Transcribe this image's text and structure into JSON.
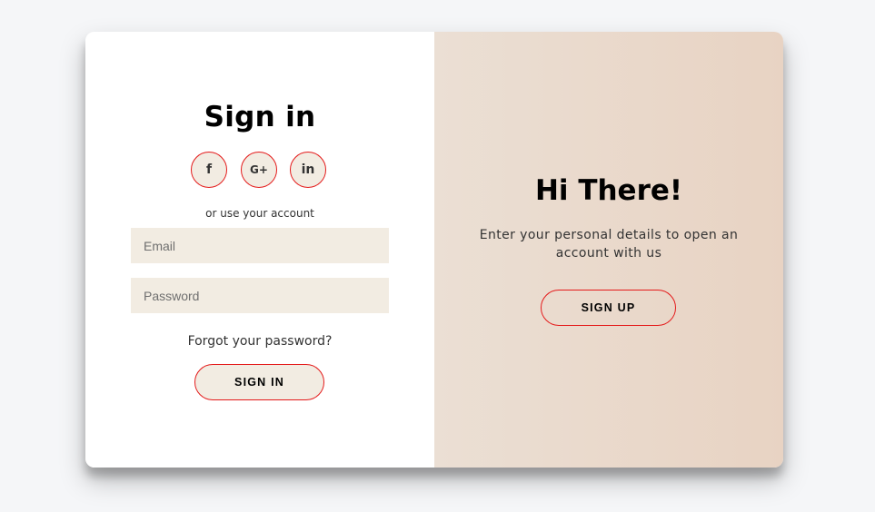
{
  "sign_in_panel": {
    "title": "Sign in",
    "social_buttons": [
      {
        "icon": "facebook-icon",
        "glyph": "f"
      },
      {
        "icon": "google-plus-icon",
        "glyph": "G+"
      },
      {
        "icon": "linkedin-icon",
        "glyph": "in"
      }
    ],
    "alt_text": "or use your account",
    "email_placeholder": "Email",
    "email_value": "",
    "password_placeholder": "Password",
    "password_value": "",
    "forgot_link": "Forgot your password?",
    "submit_label": "Sign In"
  },
  "overlay_panel": {
    "title": "Hi There!",
    "message": "Enter your personal details to open an account with us",
    "button_label": "Sign Up"
  },
  "colors": {
    "accent_border": "#e41a1a",
    "input_background": "#f2ece2",
    "overlay_gradient_start": "#ebdfd4",
    "overlay_gradient_end": "#e8d3c3",
    "page_background": "#f5f6f8"
  }
}
